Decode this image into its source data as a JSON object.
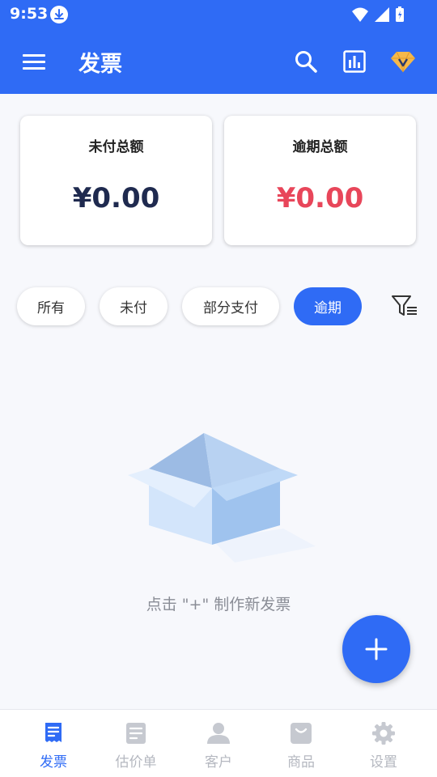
{
  "status_bar": {
    "time": "9:53"
  },
  "app_bar": {
    "title": "发票"
  },
  "summary": {
    "unpaid_label": "未付总额",
    "unpaid_amount": "¥0.00",
    "overdue_label": "逾期总额",
    "overdue_amount": "¥0.00"
  },
  "filters": {
    "chips": [
      "所有",
      "未付",
      "部分支付",
      "逾期"
    ],
    "selected": "逾期"
  },
  "empty_state": {
    "text": "点击 \"+\" 制作新发票"
  },
  "bottom_nav": {
    "items": [
      "发票",
      "估价单",
      "客户",
      "商品",
      "设置"
    ],
    "selected": "发票"
  },
  "colors": {
    "primary": "#2f6bf5",
    "overdue_red": "#e8465a",
    "unpaid_navy": "#1f2a4f",
    "premium_gold": "#f5b84a"
  },
  "icons": {
    "menu": "menu-icon",
    "search": "search-icon",
    "report": "bar-chart-icon",
    "premium": "diamond-icon",
    "filter": "filter-icon",
    "fab": "plus-icon"
  }
}
